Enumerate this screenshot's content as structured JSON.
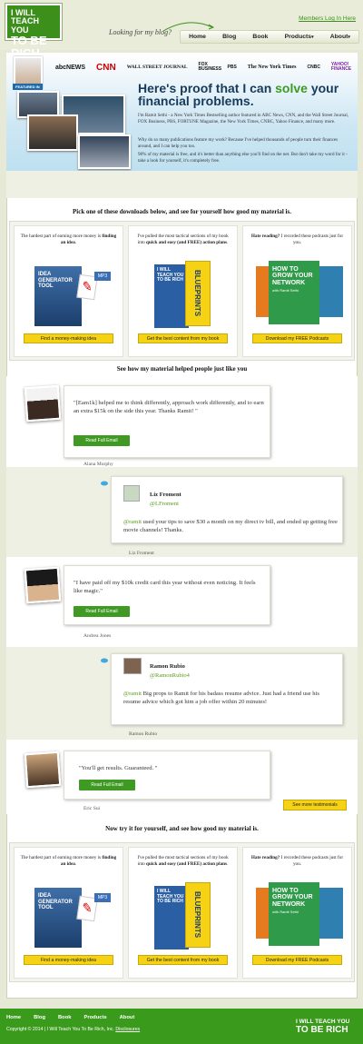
{
  "header": {
    "logo_line1": "I WILL TEACH YOU",
    "logo_line2": "TO BE RICH",
    "tagline": "Looking for my blog?",
    "members_login": "Members Log In Here",
    "nav": [
      "Home",
      "Blog",
      "Book",
      "Products",
      "About"
    ],
    "nav_dropdown_marker": "▾"
  },
  "press": {
    "featured_label": "FEATURED IN",
    "logos": [
      "abcNEWS",
      "CNN",
      "WALL STREET JOURNAL",
      "FOX BUSINESS",
      "PBS",
      "The New York Times",
      "CNBC",
      "YAHOO! FINANCE"
    ],
    "headline_pre": "Here's proof that I can ",
    "headline_accent": "solve",
    "headline_post": " your financial problems.",
    "para1": "I'm Ramit Sethi - a New York Times Bestselling author featured in ABC News, CNN, and the Wall Street Journal, FOX Business, PBS, FORTUNE Magazine, the New York Times, CNBC, Yahoo Finance, and many more.",
    "para2": "Why do so many publications feature my work? Because I've helped thousands of people turn their finances around, and I can help you too.",
    "para3": "98% of my material is free, and it's better than anything else you'll find on the net. But don't take my word for it - take a look for yourself, it's completely free."
  },
  "downloads_title_1": "Pick one of these downloads below, and see for yourself how good my material is.",
  "downloads_title_2": "Now try it for yourself, and see how good my material is.",
  "downloads": [
    {
      "text_pre": "The hardest part of earning more money is ",
      "text_bold": "finding an idea",
      "text_post": ".",
      "cover_title": "IDEA GENERATOR TOOL",
      "badge": "MP3",
      "button": "Find a money-making idea"
    },
    {
      "text_pre": "I've pulled the most tactical sections of my book into ",
      "text_bold": "quick and easy (and FREE) action plans",
      "text_post": ".",
      "cover_title": "BLUEPRINTS",
      "badge": "I WILL TEACH YOU TO BE RICH",
      "button": "Get the best content from my book"
    },
    {
      "text_pre": "",
      "text_bold": "Hate reading?",
      "text_post": " I recorded these podcasts just for you.",
      "cover_title": "HOW TO GROW YOUR NETWORK",
      "badge": "with Ramit Sethi",
      "button": "Download my FREE Podcasts"
    }
  ],
  "testimonials_title": "See how my material helped people just like you",
  "testimonials": [
    {
      "type": "email",
      "quote": "\"[Eam1k] helped me to think differently, approach work differently, and to earn an extra $15k on the side this year. Thanks Ramit! \"",
      "button": "Read Full Email",
      "name": "Alana Murphy"
    },
    {
      "type": "tweet",
      "display": "Liz Froment",
      "handle": "@LFroment",
      "mention": "@ramit",
      "text": " used your tips to save $30 a month on my direct tv bill, and ended up getting free movie channels! Thanks.",
      "name": "Liz Froment"
    },
    {
      "type": "email",
      "quote": "\"I have paid off my $10k credit card this year without even noticing. It feels like magic.\"",
      "button": "Read Full Email",
      "name": "Andrea Jones"
    },
    {
      "type": "tweet",
      "display": "Ramon Rubio",
      "handle": "@RamonRubio4",
      "mention": "@ramit",
      "text": " Big props to Ramit for his badass resume advice. Just had a friend use his resume advice which got him a job offer within 20 minutes!",
      "name": "Ramon Rubio"
    },
    {
      "type": "email",
      "quote": "\"You'll get results. Guaranteed. \"",
      "button": "Read Full Email",
      "name": "Eric Sui"
    }
  ],
  "see_more": "See more testimonials",
  "footer": {
    "nav": [
      "Home",
      "Blog",
      "Book",
      "Products",
      "About"
    ],
    "copyright": "Copyright © 2014 | I Will Teach You To Be Rich, Inc.",
    "disclosures": "Disclosures",
    "logo_line1": "I WILL TEACH YOU",
    "logo_line2": "TO BE RICH"
  },
  "colors": {
    "brand_green": "#3d8f1c",
    "headline_blue": "#163a5a",
    "button_yellow": "#f5d314"
  }
}
